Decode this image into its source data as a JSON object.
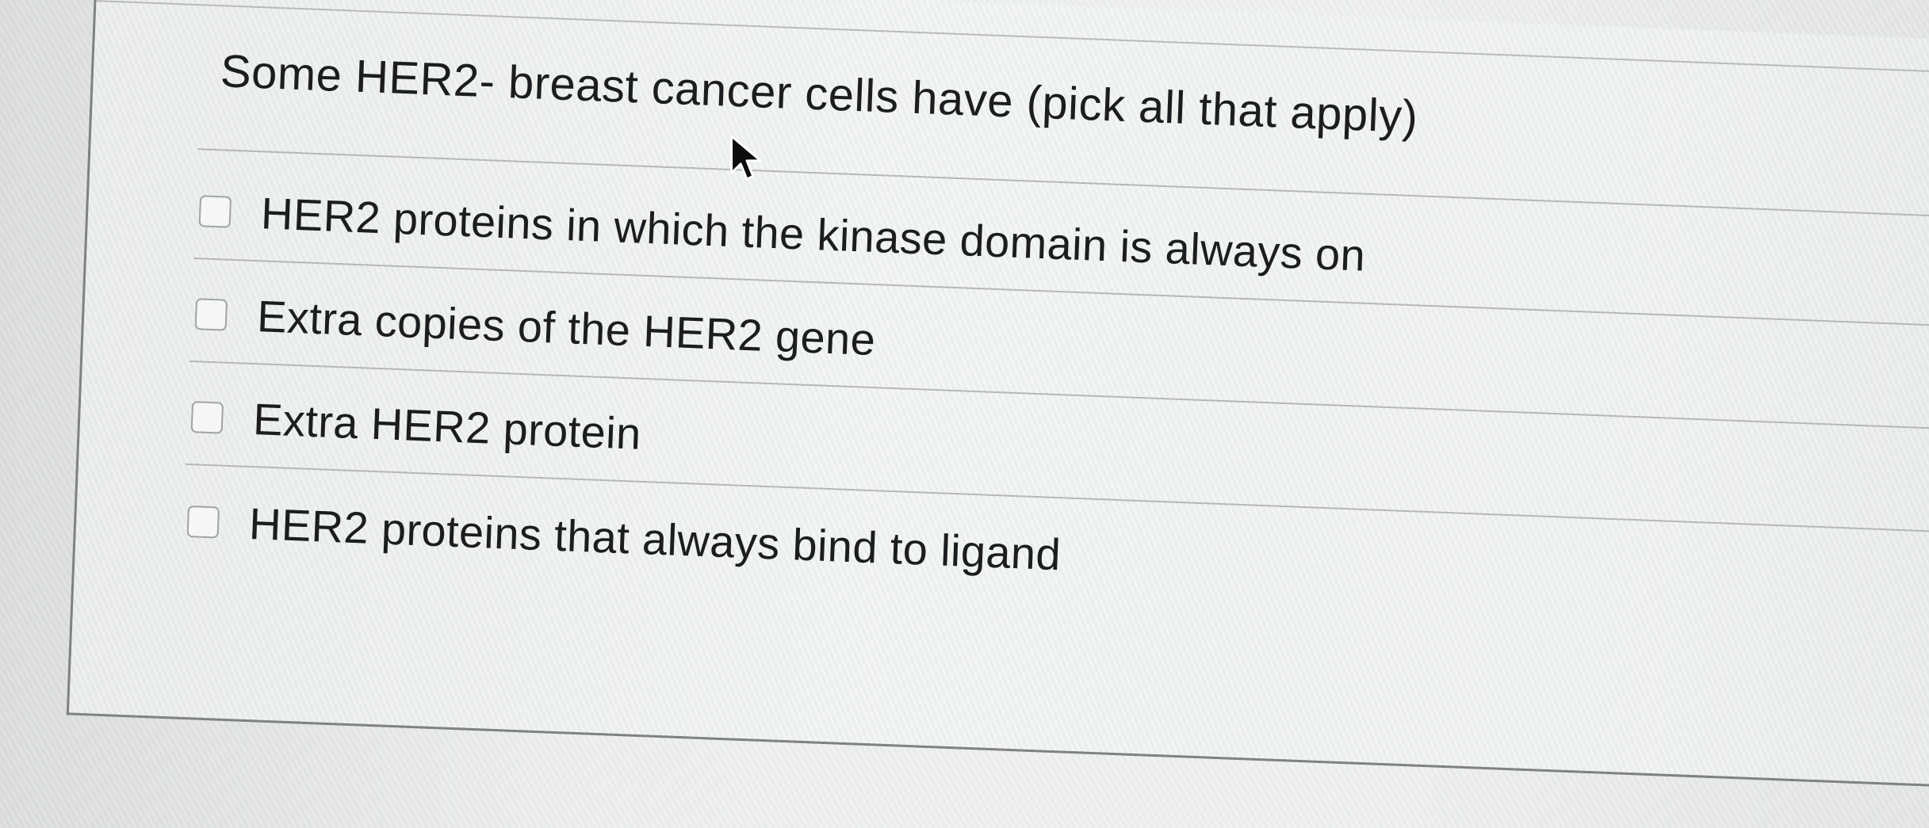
{
  "question": {
    "prompt": "Some HER2- breast cancer cells have (pick all that apply)"
  },
  "options": [
    {
      "label": "HER2 proteins in which the kinase domain is always on",
      "checked": false
    },
    {
      "label": "Extra copies of the HER2 gene",
      "checked": false
    },
    {
      "label": "Extra HER2 protein",
      "checked": false
    },
    {
      "label": "HER2 proteins that always bind to ligand",
      "checked": false
    }
  ],
  "icons": {
    "pointer": "mouse-pointer-icon"
  },
  "colors": {
    "text": "#1c1d1e",
    "checkbox_border": "#a0a4a2",
    "divider": "#b5b8b6"
  }
}
